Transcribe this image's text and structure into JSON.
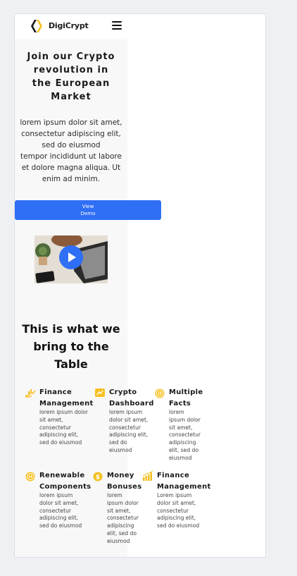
{
  "header": {
    "brand": "DigiCrypt"
  },
  "hero": {
    "title_lines": [
      "Join our Crypto",
      "revolution in",
      "the European",
      "Market"
    ],
    "text_lines": [
      "lorem ipsum dolor sit amet,",
      "consectetur adipiscing elit,",
      "sed do eiusmod",
      "tempor incididunt ut labore",
      "et dolore magna aliqua. Ut",
      "enim ad minim."
    ],
    "button_lines": [
      "View",
      "Demo"
    ]
  },
  "section": {
    "title_lines": [
      "This is what we",
      "bring to the",
      "Table"
    ]
  },
  "features": [
    {
      "icon": "chart-hand-icon",
      "title_lines": [
        "Finance",
        "Management"
      ],
      "desc_lines": [
        "lorem ipsum dolor",
        "sit amet,",
        "consectetur",
        "adipiscing elit,",
        "sed do eiusmod"
      ]
    },
    {
      "icon": "dashboard-icon",
      "title_lines": [
        "Crypto",
        "Dashboard"
      ],
      "desc_lines": [
        "lorem ipsum",
        "dolor sit amet,",
        "consectetur",
        "adipiscing elit,",
        "sed do",
        "eiusmod"
      ]
    },
    {
      "icon": "coins-icon",
      "title_lines": [
        "Multiple",
        "Facts"
      ],
      "desc_lines": [
        "lorem",
        "ipsum dolor",
        "sit amet,",
        "consectetur",
        "adipiscing",
        "elit, sed do",
        "eiusmod"
      ]
    },
    {
      "icon": "renewable-icon",
      "title_lines": [
        "Renewable",
        "Components"
      ],
      "desc_lines": [
        "lorem ipsum",
        "dolor sit amet,",
        "consectetur",
        "adipiscing elit,",
        "sed do eiusmod"
      ]
    },
    {
      "icon": "money-icon",
      "title_lines": [
        "Money",
        "Bonuses"
      ],
      "desc_lines": [
        "lorem",
        "ipsum dolor",
        "sit amet,",
        "consectetur",
        "adipiscing",
        "elit, sed do",
        "eiusmod"
      ]
    },
    {
      "icon": "bar-growth-icon",
      "title_lines": [
        "Finance",
        "Management"
      ],
      "desc_lines": [
        "Lorem ipsum",
        "dolor sit amet,",
        "consectetur",
        "adipiscing elit,",
        "sed do eiusmod"
      ]
    }
  ],
  "colors": {
    "accent": "#2f6ff6",
    "icon": "#f5c021"
  }
}
